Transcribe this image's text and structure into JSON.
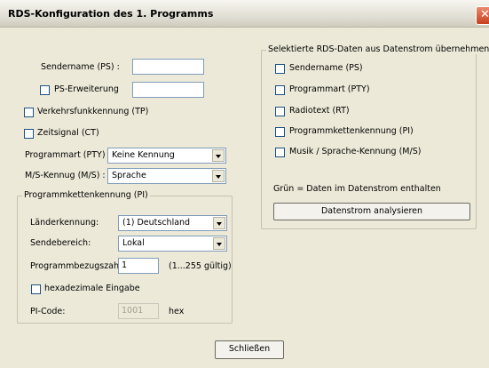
{
  "window": {
    "title": "RDS-Konfiguration des 1. Programms",
    "close_glyph": "✕"
  },
  "left": {
    "sendername_label": "Sendername (PS) :",
    "sendername_value": "",
    "ps_erweiterung_label": "PS-Erweiterung",
    "ps_erweiterung_value": "",
    "ps_erweiterung_checked": false,
    "tp_label": "Verkehrsfunkkennung (TP)",
    "tp_checked": false,
    "ct_label": "Zeitsignal (CT)",
    "ct_checked": false,
    "pty_label": "Programmart (PTY) :",
    "pty_value": "Keine Kennung",
    "ms_label": "M/S-Kennug (M/S) :",
    "ms_value": "Sprache"
  },
  "pi_group": {
    "title": "Programmkettenkennung (PI)",
    "laender_label": "Länderkennung:",
    "laender_value": "(1) Deutschland",
    "sendebereich_label": "Sendebereich:",
    "sendebereich_value": "Lokal",
    "bezugszahl_label": "Programmbezugszahl:",
    "bezugszahl_value": "1",
    "bezugszahl_hint": "(1...255 gültig)",
    "hex_label": "hexadezimale Eingabe",
    "hex_checked": false,
    "picode_label": "PI-Code:",
    "picode_value": "1001",
    "picode_unit": "hex"
  },
  "rds_group": {
    "title": "Selektierte RDS-Daten aus Datenstrom übernehmen",
    "items": [
      {
        "label": "Sendername (PS)",
        "checked": false
      },
      {
        "label": "Programmart (PTY)",
        "checked": false
      },
      {
        "label": "Radiotext (RT)",
        "checked": false
      },
      {
        "label": "Programmkettenkennung (PI)",
        "checked": false
      },
      {
        "label": "Musik / Sprache-Kennung (M/S)",
        "checked": false
      }
    ],
    "note": "Grün = Daten im Datenstrom enthalten",
    "analyze_button": "Datenstrom analysieren"
  },
  "footer": {
    "close_button": "Schließen"
  }
}
